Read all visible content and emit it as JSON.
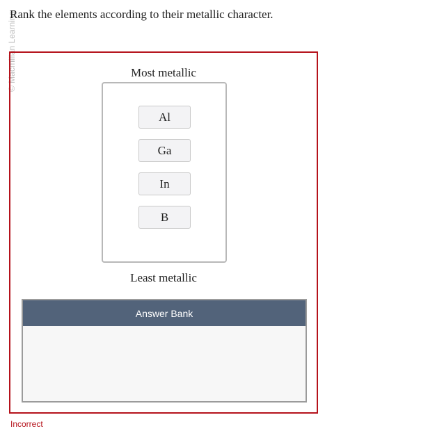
{
  "watermark": "© Macmillan Learning",
  "question": {
    "prompt": "Rank the elements according to their metallic character."
  },
  "ranking": {
    "top_label": "Most metallic",
    "bottom_label": "Least metallic",
    "items": [
      "Al",
      "Ga",
      "In",
      "B"
    ]
  },
  "answer_bank": {
    "title": "Answer Bank",
    "items": []
  },
  "feedback": {
    "status": "Incorrect"
  },
  "colors": {
    "error": "#b5121b",
    "bank_header": "#52637a",
    "tile_bg": "#f3f3f5"
  }
}
